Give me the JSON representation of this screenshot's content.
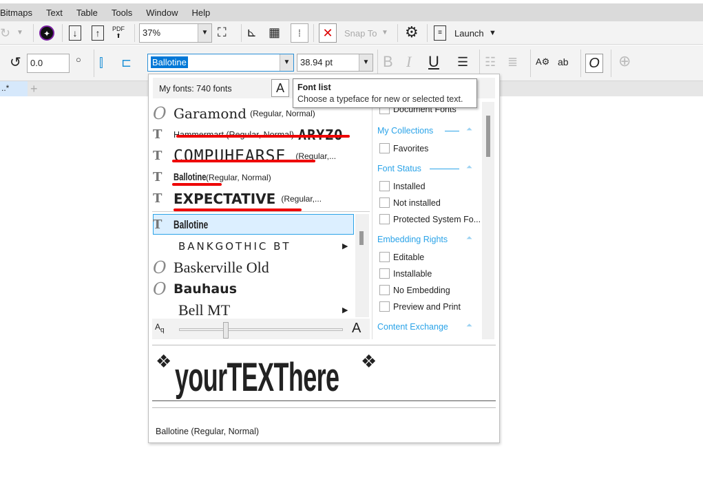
{
  "menu": [
    "Bitmaps",
    "Text",
    "Table",
    "Tools",
    "Window",
    "Help"
  ],
  "toolbar1": {
    "zoom": "37%",
    "snap_to": "Snap To",
    "launch": "Launch"
  },
  "toolbar2": {
    "rotation": "0.0",
    "font": "Ballotine",
    "size": "38.94 pt",
    "bold": "B",
    "italic": "I",
    "underline": "U",
    "char_label": "ab"
  },
  "tab": {
    "label": "..*"
  },
  "tooltip": {
    "title": "Font list",
    "text": "Choose a typeface for new or selected text."
  },
  "panel": {
    "my_fonts": "My fonts: 740 fonts",
    "recent": [
      {
        "name": "Garamond",
        "style": "(Regular, Normal)",
        "icon": "opentype-icon"
      },
      {
        "name": "Hammermart (Regular, Normal)",
        "sample": "ARYZO",
        "icon": "truetype-icon"
      },
      {
        "name": "COMPUHEARSE",
        "style": "(Regular,...",
        "icon": "truetype-icon"
      },
      {
        "name": "Ballotine",
        "style": "(Regular, Normal)",
        "icon": "truetype-icon"
      },
      {
        "name": "EXPECTATIVE",
        "style": "(Regular,...",
        "icon": "truetype-icon"
      }
    ],
    "list": [
      {
        "name": "Ballotine",
        "icon": "truetype-icon",
        "selected": true
      },
      {
        "name": "BankGothic BT",
        "icon": "",
        "submenu": true
      },
      {
        "name": "Baskerville Old",
        "icon": "opentype-icon"
      },
      {
        "name": "Bauhaus",
        "icon": "opentype-icon"
      },
      {
        "name": "Bell MT",
        "icon": "",
        "submenu": true
      }
    ],
    "filters": {
      "partial": "Document Fonts",
      "groups": [
        {
          "title": "My Collections",
          "items": [
            "Favorites"
          ]
        },
        {
          "title": "Font Status",
          "items": [
            "Installed",
            "Not installed",
            "Protected System Fo..."
          ]
        },
        {
          "title": "Embedding Rights",
          "items": [
            "Editable",
            "Installable",
            "No Embedding",
            "Preview and Print"
          ]
        },
        {
          "title": "Content Exchange",
          "items": []
        }
      ]
    },
    "preview_text": "yourTEXThere",
    "preview_caption": "Ballotine (Regular, Normal)"
  },
  "colors": {
    "accent": "#2aa3e8",
    "selection": "#0078d7",
    "underline": "#e00000"
  }
}
